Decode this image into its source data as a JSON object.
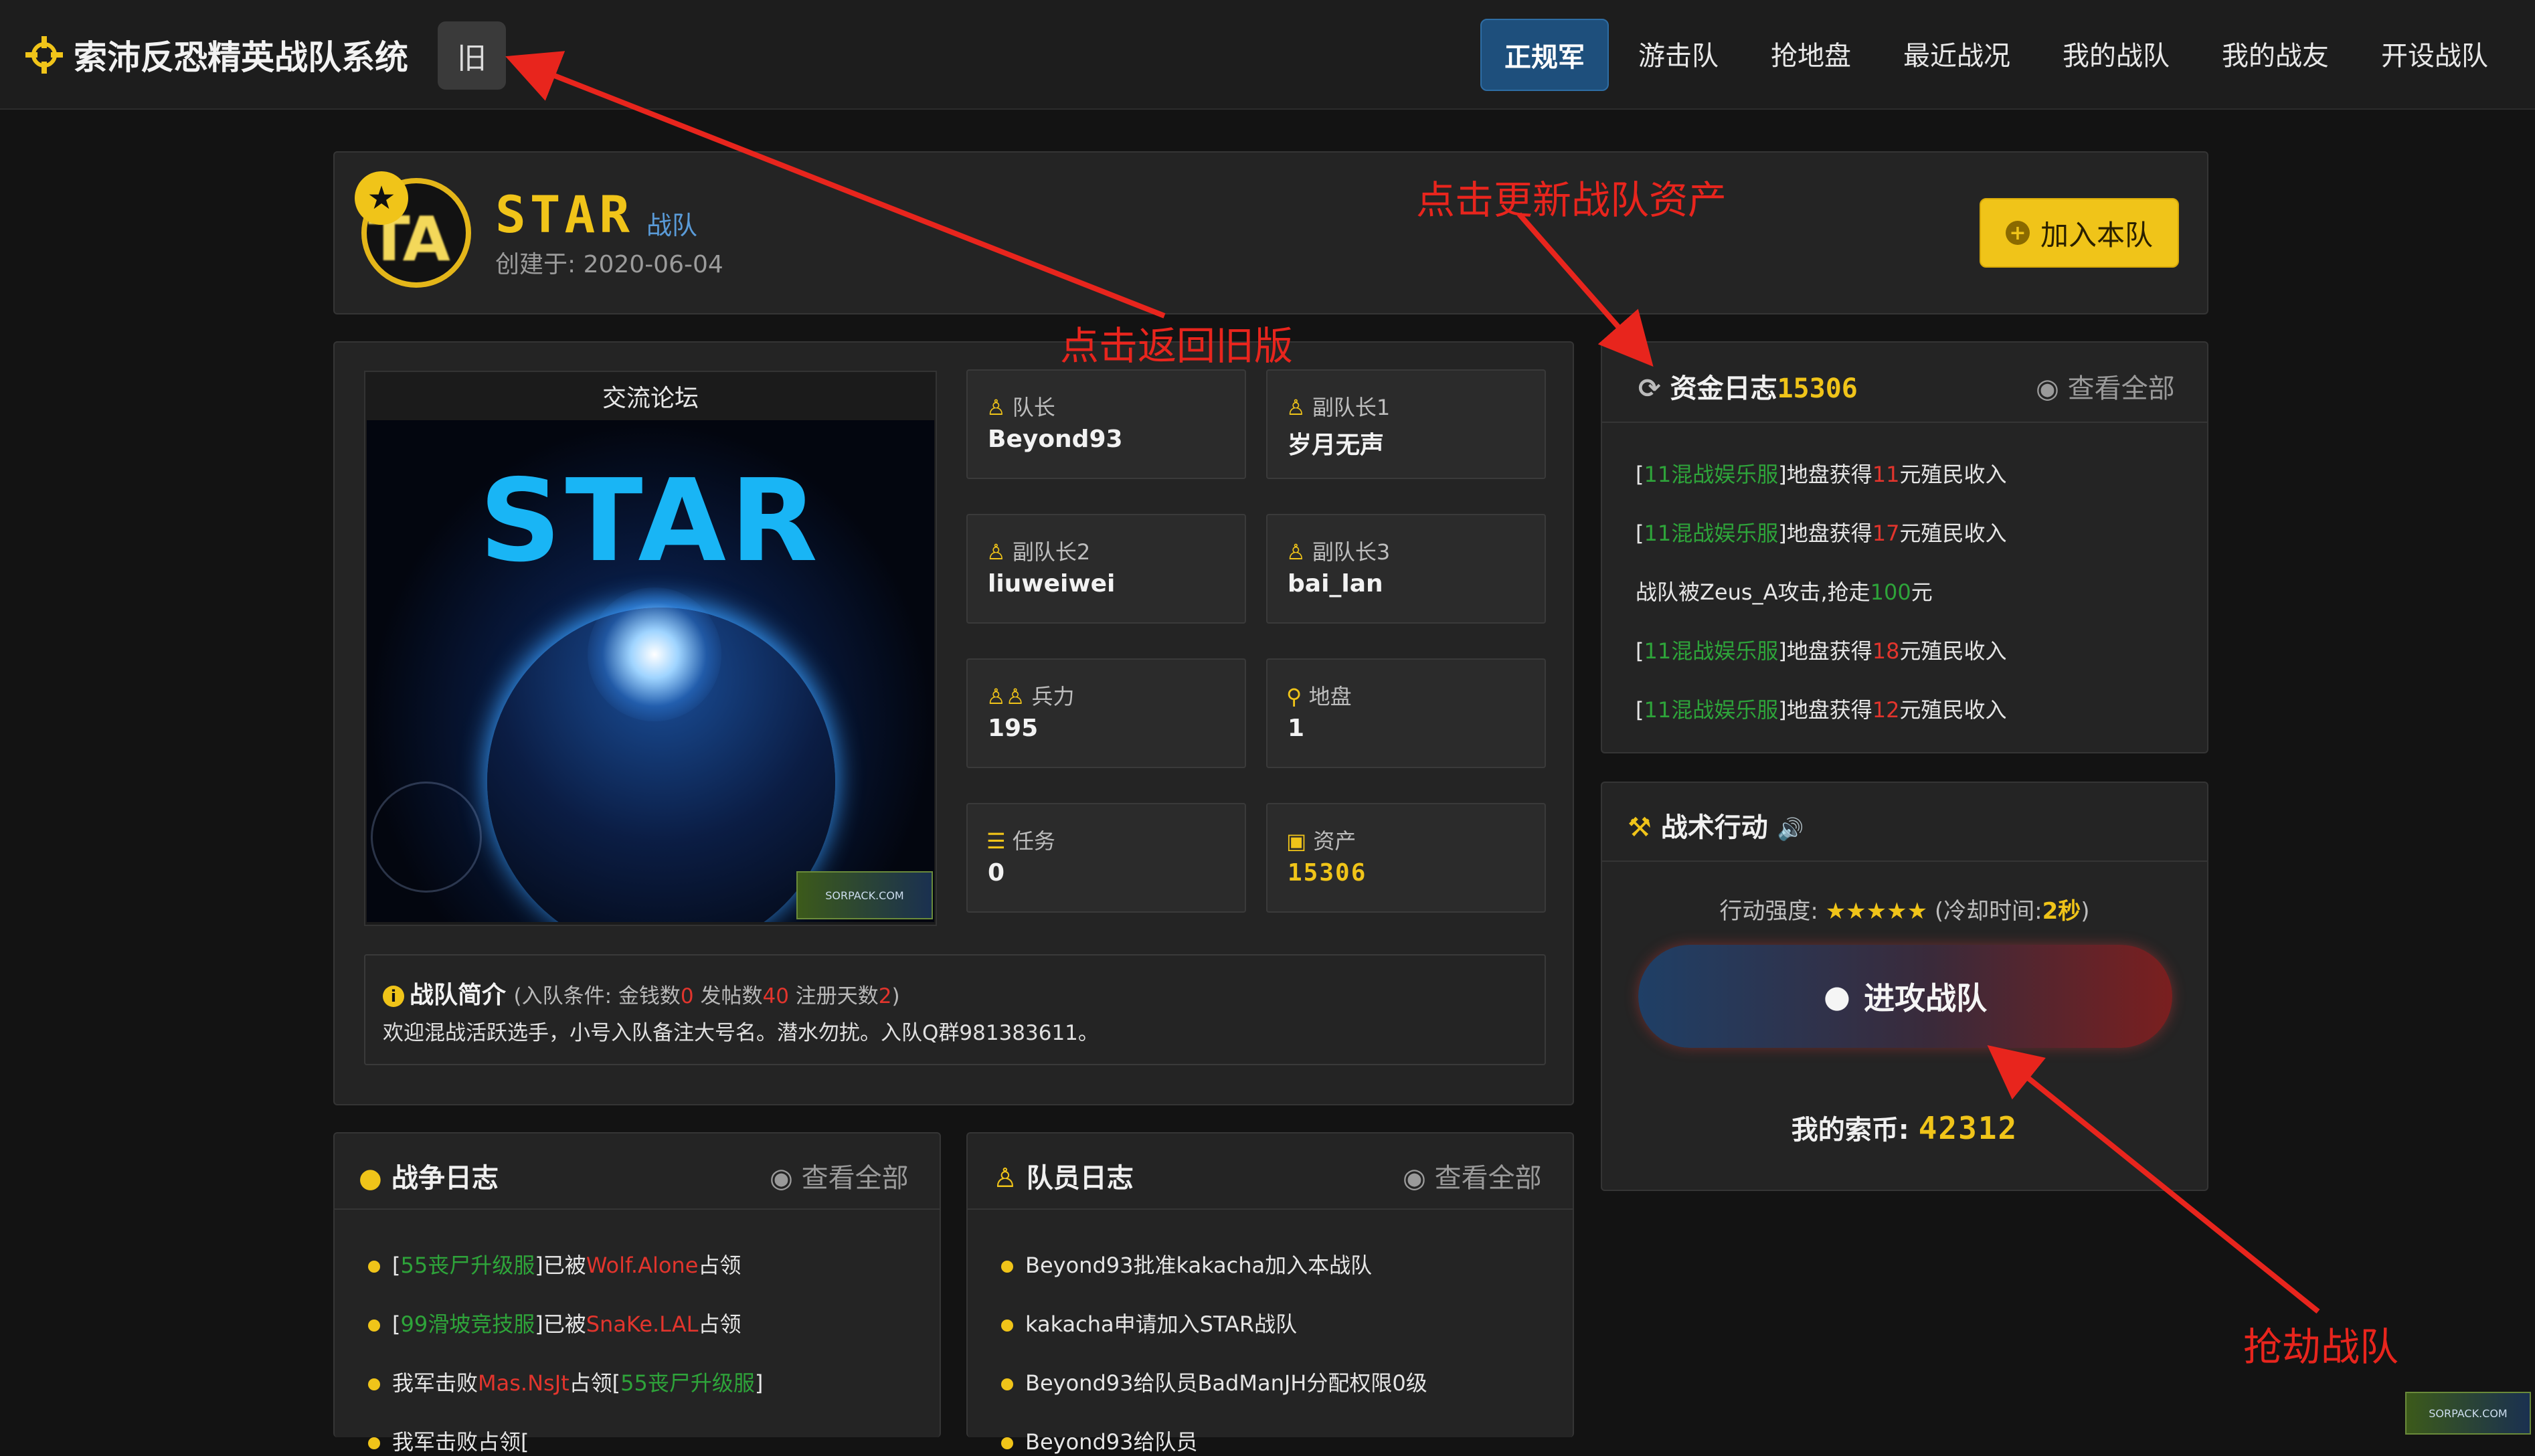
{
  "nav": {
    "brand": "索沛反恐精英战队系统",
    "old_label": "旧",
    "items": [
      "正规军",
      "游击队",
      "抢地盘",
      "最近战况",
      "我的战队",
      "我的战友",
      "开设战队"
    ]
  },
  "team": {
    "name": "STAR",
    "type_label": "战队",
    "created": "创建于: 2020-06-04",
    "join_label": "加入本队",
    "logo_text": "TA"
  },
  "forum": {
    "title": "交流论坛",
    "image_text": "STAR",
    "watermark": "SORPACK.COM"
  },
  "stats": [
    {
      "label": "队长",
      "value": "Beyond93"
    },
    {
      "label": "副队长1",
      "value": "岁月无声"
    },
    {
      "label": "副队长2",
      "value": "liuweiwei"
    },
    {
      "label": "副队长3",
      "value": "bai_lan"
    },
    {
      "label": "兵力",
      "value": "195"
    },
    {
      "label": "地盘",
      "value": "1"
    },
    {
      "label": "任务",
      "value": "0"
    },
    {
      "label": "资产",
      "value": "15306"
    }
  ],
  "intro": {
    "title": "战队简介",
    "cond_pre": "(入队条件: 金钱数",
    "money": "0",
    "cond_mid1": " 发帖数",
    "posts": "40",
    "cond_mid2": " 注册天数",
    "days": "2",
    "cond_end": ")",
    "text": "欢迎混战活跃选手，小号入队备注大号名。潜水勿扰。入队Q群981383611。"
  },
  "funds": {
    "title": "资金日志",
    "amount": "15306",
    "view_all": "查看全部",
    "lines": [
      {
        "kind": "land",
        "server": "11混战娱乐服",
        "mid": "]地盘获得",
        "value": "11",
        "tail": "元殖民收入"
      },
      {
        "kind": "land",
        "server": "11混战娱乐服",
        "mid": "]地盘获得",
        "value": "17",
        "tail": "元殖民收入"
      },
      {
        "kind": "attack",
        "pre": "战队被Zeus_A攻击,抢走",
        "value": "100",
        "tail": "元"
      },
      {
        "kind": "land",
        "server": "11混战娱乐服",
        "mid": "]地盘获得",
        "value": "18",
        "tail": "元殖民收入"
      },
      {
        "kind": "land",
        "server": "11混战娱乐服",
        "mid": "]地盘获得",
        "value": "12",
        "tail": "元殖民收入"
      }
    ]
  },
  "tactics": {
    "title": "战术行动",
    "strength_label": "行动强度: ",
    "stars": "★★★★★",
    "cooldown_pre": " (冷却时间:",
    "cooldown": "2秒",
    "cooldown_end": ")",
    "attack_label": "进攻战队",
    "coins_label": "我的索币: ",
    "coins": "42312"
  },
  "war_log": {
    "title": "战争日志",
    "view_all": "查看全部",
    "lines": [
      {
        "a": "[",
        "b": "55丧尸升级服",
        "c": "]已被",
        "d": "Wolf.Alone",
        "e": "占领",
        "f": ""
      },
      {
        "a": "[",
        "b": "99滑坡竞技服",
        "c": "]已被",
        "d": "SnaKe.LAL",
        "e": "占领",
        "f": ""
      },
      {
        "a": "我军击败",
        "b": "Mas.NsJt",
        "c": "占领[",
        "d": "55丧尸升级服",
        "e": "]",
        "f": ""
      },
      {
        "a": "我军击败",
        "b": "",
        "c": "占领[",
        "d": "",
        "e": "",
        "f": ""
      }
    ]
  },
  "member_log": {
    "title": "队员日志",
    "view_all": "查看全部",
    "lines": [
      "Beyond93批准kakacha加入本战队",
      "kakacha申请加入STAR战队",
      "Beyond93给队员BadManJH分配权限0级",
      "Beyond93给队员"
    ]
  },
  "annotations": {
    "back_old": "点击返回旧版",
    "update_assets": "点击更新战队资产",
    "rob_team": "抢劫战队"
  },
  "colors": {
    "gold": "#f0c419",
    "nav_active": "#1e4f7c",
    "annotation": "#e8251d",
    "green": "#2ea43a",
    "red": "#e2352d"
  }
}
